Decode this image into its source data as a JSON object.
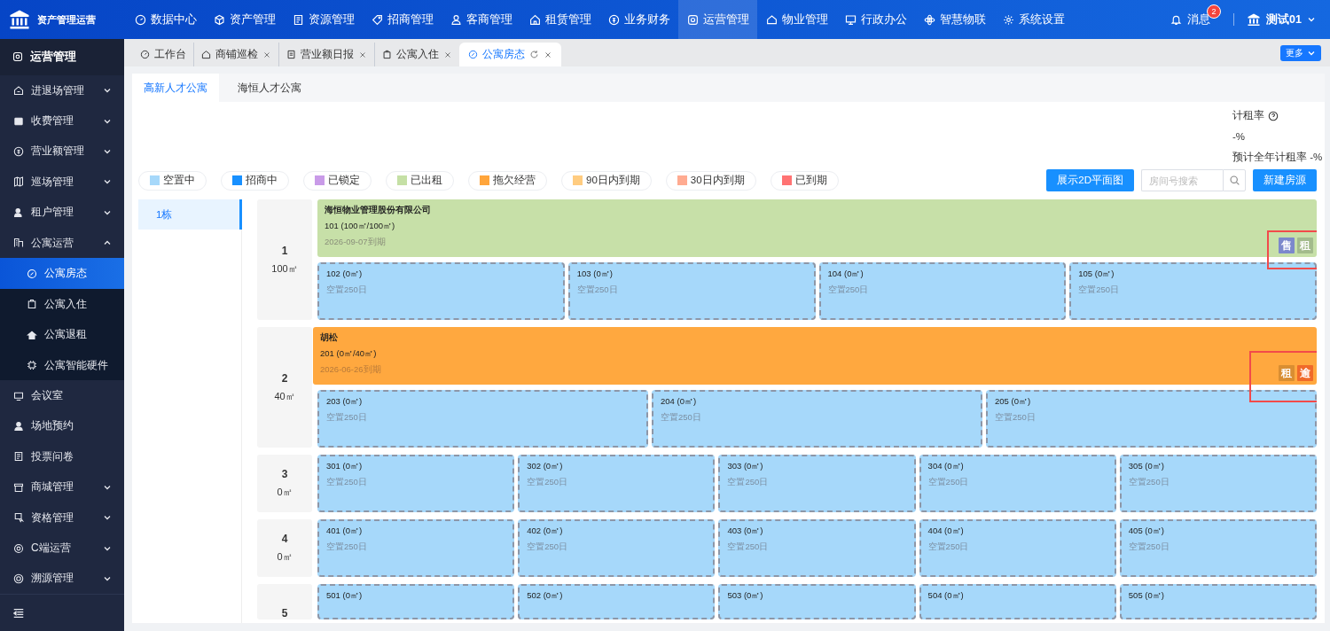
{
  "app": {
    "title": "资产管理运营"
  },
  "top_nav": [
    {
      "label": "数据中心",
      "selected": false
    },
    {
      "label": "资产管理",
      "selected": false
    },
    {
      "label": "资源管理",
      "selected": false
    },
    {
      "label": "招商管理",
      "selected": false
    },
    {
      "label": "客商管理",
      "selected": false
    },
    {
      "label": "租赁管理",
      "selected": false
    },
    {
      "label": "业务财务",
      "selected": false
    },
    {
      "label": "运营管理",
      "selected": true
    },
    {
      "label": "物业管理",
      "selected": false
    },
    {
      "label": "行政办公",
      "selected": false
    },
    {
      "label": "智慧物联",
      "selected": false
    },
    {
      "label": "系统设置",
      "selected": false
    }
  ],
  "notifications": {
    "label": "消息",
    "badge": "2"
  },
  "user": {
    "name": "测试01"
  },
  "sidebar": {
    "title": "运营管理",
    "items": [
      {
        "label": "进退场管理",
        "kind": "group",
        "expanded": false
      },
      {
        "label": "收费管理",
        "kind": "group",
        "expanded": false
      },
      {
        "label": "营业额管理",
        "kind": "group",
        "expanded": false
      },
      {
        "label": "巡场管理",
        "kind": "group",
        "expanded": false
      },
      {
        "label": "租户管理",
        "kind": "group",
        "expanded": false
      },
      {
        "label": "公寓运营",
        "kind": "group",
        "expanded": true,
        "children": [
          {
            "label": "公寓房态",
            "selected": true
          },
          {
            "label": "公寓入住",
            "selected": false
          },
          {
            "label": "公寓退租",
            "selected": false
          },
          {
            "label": "公寓智能硬件",
            "selected": false
          }
        ]
      },
      {
        "label": "会议室",
        "kind": "link"
      },
      {
        "label": "场地预约",
        "kind": "link"
      },
      {
        "label": "投票问卷",
        "kind": "link"
      },
      {
        "label": "商城管理",
        "kind": "group",
        "expanded": false
      },
      {
        "label": "资格管理",
        "kind": "group",
        "expanded": false
      },
      {
        "label": "C端运营",
        "kind": "group",
        "expanded": false
      },
      {
        "label": "溯源管理",
        "kind": "group",
        "expanded": false
      }
    ]
  },
  "tabs": [
    {
      "label": "工作台",
      "selected": false,
      "closable": false
    },
    {
      "label": "商铺巡检",
      "selected": false,
      "closable": true
    },
    {
      "label": "营业额日报",
      "selected": false,
      "closable": true
    },
    {
      "label": "公寓入住",
      "selected": false,
      "closable": true
    },
    {
      "label": "公寓房态",
      "selected": true,
      "closable": true
    }
  ],
  "more_button": "更多",
  "page_tabs": [
    {
      "label": "高新人才公寓",
      "selected": true
    },
    {
      "label": "海恒人才公寓",
      "selected": false
    }
  ],
  "stats": {
    "rate_label": "计租率",
    "rate_value": "-%",
    "annual_label": "预计全年计租率",
    "annual_value": "-%"
  },
  "legend": [
    {
      "label": "空置中",
      "color": "#a6d8fa"
    },
    {
      "label": "招商中",
      "color": "#1890ff"
    },
    {
      "label": "已锁定",
      "color": "#c99be8"
    },
    {
      "label": "已出租",
      "color": "#c5e0a5"
    },
    {
      "label": "拖欠经营",
      "color": "#ffa53b"
    },
    {
      "label": "90日内到期",
      "color": "#ffcc80"
    },
    {
      "label": "30日内到期",
      "color": "#ffab91"
    },
    {
      "label": "已到期",
      "color": "#ff7373"
    }
  ],
  "actions": {
    "plan_button": "展示2D平面图",
    "search": {
      "placeholder": "房间号搜索"
    },
    "new_button": "新建房源"
  },
  "buildings": [
    {
      "label": "1栋",
      "selected": true
    }
  ],
  "floors": [
    {
      "number": "1",
      "area": "100㎡",
      "occupied": [
        {
          "kind": "rented",
          "tenant": "海恒物业管理股份有限公司",
          "name": "101 (100㎡/100㎡)",
          "due": "2026-09-07到期",
          "highlighted": true,
          "tags": [
            {
              "label": "售",
              "color": "#7c88cc"
            },
            {
              "label": "租",
              "color": "#a3bb8c"
            }
          ]
        }
      ],
      "vacant": [
        {
          "name": "102 (0㎡)",
          "note": "空置250日"
        },
        {
          "name": "103 (0㎡)",
          "note": "空置250日"
        },
        {
          "name": "104 (0㎡)",
          "note": "空置250日"
        },
        {
          "name": "105 (0㎡)",
          "note": "空置250日"
        }
      ]
    },
    {
      "number": "2",
      "area": "40㎡",
      "occupied": [
        {
          "kind": "overdue",
          "tenant": "胡松",
          "name": "201 (0㎡/40㎡)",
          "due": "2026-06-26到期",
          "highlighted": true,
          "tags": [
            {
              "label": "租",
              "color": "#d98e32"
            },
            {
              "label": "逾",
              "color": "#f06a2a"
            }
          ]
        }
      ],
      "vacant": [
        {
          "name": "203 (0㎡)",
          "note": "空置250日"
        },
        {
          "name": "204 (0㎡)",
          "note": "空置250日"
        },
        {
          "name": "205 (0㎡)",
          "note": "空置250日"
        }
      ]
    },
    {
      "number": "3",
      "area": "0㎡",
      "vacant": [
        {
          "name": "301 (0㎡)",
          "note": "空置250日"
        },
        {
          "name": "302 (0㎡)",
          "note": "空置250日"
        },
        {
          "name": "303 (0㎡)",
          "note": "空置250日"
        },
        {
          "name": "304 (0㎡)",
          "note": "空置250日"
        },
        {
          "name": "305 (0㎡)",
          "note": "空置250日"
        }
      ]
    },
    {
      "number": "4",
      "area": "0㎡",
      "vacant": [
        {
          "name": "401 (0㎡)",
          "note": "空置250日"
        },
        {
          "name": "402 (0㎡)",
          "note": "空置250日"
        },
        {
          "name": "403 (0㎡)",
          "note": "空置250日"
        },
        {
          "name": "404 (0㎡)",
          "note": "空置250日"
        },
        {
          "name": "405 (0㎡)",
          "note": "空置250日"
        }
      ]
    },
    {
      "number": "5",
      "vacant": [
        {
          "name": "501 (0㎡)"
        },
        {
          "name": "502 (0㎡)"
        },
        {
          "name": "503 (0㎡)"
        },
        {
          "name": "504 (0㎡)"
        },
        {
          "name": "505 (0㎡)"
        }
      ]
    }
  ]
}
